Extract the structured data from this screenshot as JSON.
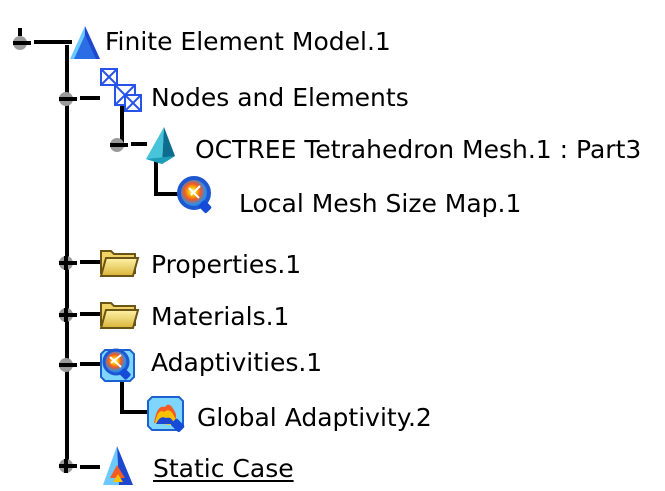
{
  "tree": {
    "nodes": [
      {
        "label": "Finite Element Model.1",
        "icon": "fem-model-icon",
        "toggle": "expanded"
      },
      {
        "label": "Nodes and Elements",
        "icon": "nodes-elements-icon",
        "toggle": "expanded"
      },
      {
        "label": "OCTREE Tetrahedron Mesh.1 : Part3",
        "icon": "mesh-icon",
        "toggle": "expanded"
      },
      {
        "label": "Local Mesh Size Map.1",
        "icon": "mesh-size-map-icon",
        "toggle": "none"
      },
      {
        "label": "Properties.1",
        "icon": "folder-icon",
        "toggle": "collapsed"
      },
      {
        "label": "Materials.1",
        "icon": "folder-icon",
        "toggle": "collapsed"
      },
      {
        "label": "Adaptivities.1",
        "icon": "adaptivity-icon",
        "toggle": "expanded"
      },
      {
        "label": "Global Adaptivity.2",
        "icon": "global-adaptivity-icon",
        "toggle": "none"
      },
      {
        "label": "Static Case",
        "icon": "static-case-icon",
        "toggle": "collapsed"
      }
    ]
  },
  "colors": {
    "tree_line": "#000000",
    "toggle_fill": "#9a9a9a",
    "mesh_blue": "#1447d8",
    "mesh_cyan": "#24b6d1",
    "folder_yellow": "#f2d15d",
    "folder_shadow": "#c2a22b",
    "adapt_red": "#ef3f26",
    "adapt_blue": "#1d79d9",
    "link_text": "#000000"
  }
}
